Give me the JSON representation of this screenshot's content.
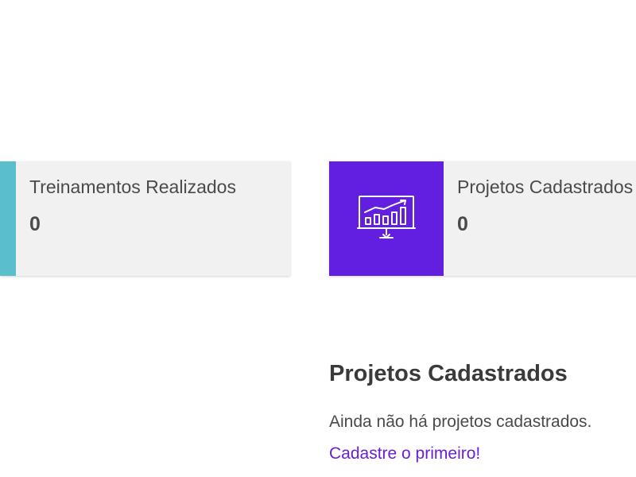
{
  "colors": {
    "trainings_accent": "#5bbfcb",
    "projects_accent": "#631fdf",
    "link": "#6a1fd6"
  },
  "cards": {
    "trainings": {
      "label": "Treinamentos Realizados",
      "value": "0"
    },
    "projects": {
      "label": "Projetos Cadastrados",
      "value": "0",
      "icon": "presentation-chart-icon"
    }
  },
  "projects_section": {
    "title": "Projetos Cadastrados",
    "empty_message": "Ainda não há projetos cadastrados.",
    "cta_link": "Cadastre o primeiro!"
  }
}
